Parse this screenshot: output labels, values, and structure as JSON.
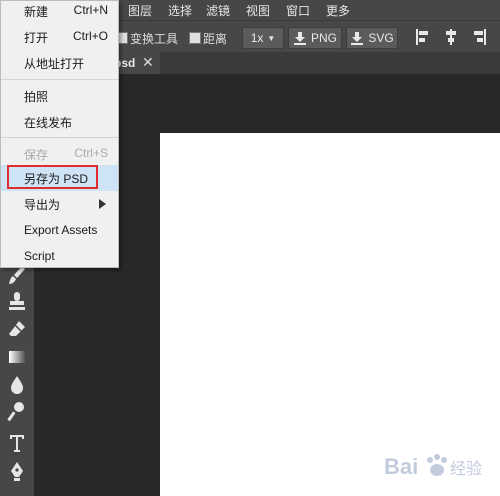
{
  "menubar": {
    "items": [
      "图层",
      "选择",
      "滤镜",
      "视图",
      "窗口",
      "更多"
    ]
  },
  "options": {
    "transform_label": "变换工具",
    "distance_label": "距离",
    "scale_value": "1x",
    "png_label": "PNG",
    "svg_label": "SVG"
  },
  "tab": {
    "label": "psd",
    "close": "✕"
  },
  "dropdown": {
    "items": [
      {
        "label": "新建",
        "shortcut": "Ctrl+N"
      },
      {
        "label": "打开",
        "shortcut": "Ctrl+O"
      },
      {
        "label": "从地址打开",
        "shortcut": ""
      },
      {
        "label": "拍照",
        "shortcut": ""
      },
      {
        "label": "在线发布",
        "shortcut": ""
      },
      {
        "label": "保存",
        "shortcut": "Ctrl+S"
      },
      {
        "label": "另存为 PSD",
        "shortcut": ""
      },
      {
        "label": "导出为",
        "shortcut": ""
      },
      {
        "label": "Export Assets",
        "shortcut": ""
      },
      {
        "label": "Script",
        "shortcut": ""
      }
    ]
  },
  "watermark": {
    "brand": "Bai",
    "suffix": "经验"
  },
  "colors": {
    "highlight": "#cfe3f7",
    "annotation_box": "#e02c2c",
    "canvas": "#ffffff"
  }
}
